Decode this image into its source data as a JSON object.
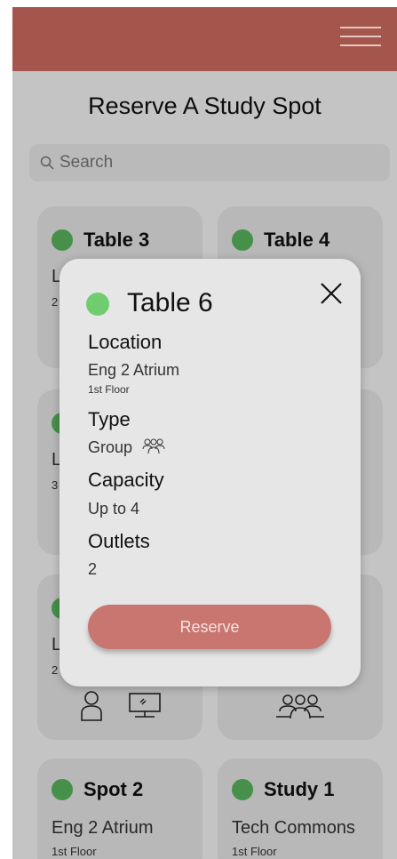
{
  "page_title": "Reserve A Study Spot",
  "search": {
    "placeholder": "Search"
  },
  "colors": {
    "header": "#a4564d",
    "available": "#59b45d",
    "reserve_button": "#c8766f"
  },
  "cards": [
    {
      "name": "Table 3",
      "location": "L",
      "floor": "2"
    },
    {
      "name": "Table 4"
    },
    {
      "location": "L",
      "floor": "3"
    },
    {
      "location": "L",
      "floor": "2",
      "icons": [
        "person-icon",
        "computer-icon"
      ]
    },
    {
      "icons": [
        "group-icon"
      ]
    },
    {
      "name": "Spot 2",
      "location": "Eng 2 Atrium",
      "floor": "1st Floor"
    },
    {
      "name": "Study 1",
      "location": "Tech Commons",
      "floor": "1st Floor"
    }
  ],
  "modal": {
    "title": "Table 6",
    "location_label": "Location",
    "location_value": "Eng 2 Atrium",
    "location_floor": "1st Floor",
    "type_label": "Type",
    "type_value": "Group",
    "capacity_label": "Capacity",
    "capacity_value": "Up to 4",
    "outlets_label": "Outlets",
    "outlets_value": "2",
    "reserve_label": "Reserve"
  }
}
